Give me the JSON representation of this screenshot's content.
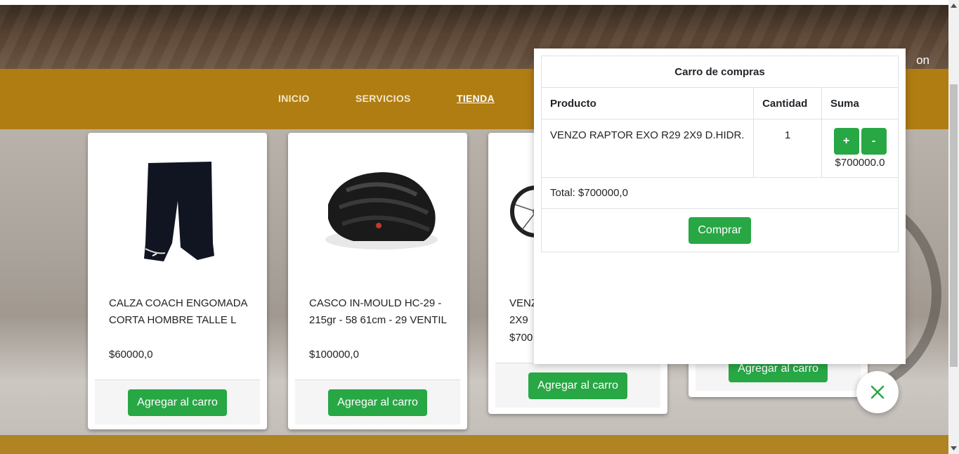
{
  "hero": {
    "login_text": "on"
  },
  "nav": {
    "items": [
      {
        "label": "INICIO",
        "active": false
      },
      {
        "label": "SERVICIOS",
        "active": false
      },
      {
        "label": "TIENDA",
        "active": true
      }
    ]
  },
  "products": [
    {
      "name": "CALZA COACH ENGOMADA CORTA HOMBRE TALLE L",
      "price": "$60000,0",
      "button": "Agregar al carro",
      "icon": "shorts-icon"
    },
    {
      "name": "CASCO IN-MOULD HC-29 - 215gr - 58 61cm - 29 VENTIL",
      "price": "$100000,0",
      "button": "Agregar al carro",
      "icon": "helmet-icon"
    },
    {
      "name": "VENZ 2X9",
      "price": "$700",
      "button": "Agregar al carro",
      "icon": "bicycle-icon"
    },
    {
      "name": "",
      "price": "",
      "button": "Agregar al carro",
      "icon": ""
    }
  ],
  "cart": {
    "title": "Carro de compras",
    "headers": {
      "product": "Producto",
      "quantity": "Cantidad",
      "sum": "Suma"
    },
    "items": [
      {
        "product": "VENZO RAPTOR EXO R29 2X9 D.HIDR.",
        "quantity": "1",
        "plus": "+",
        "minus": "-",
        "sum": "$700000.0"
      }
    ],
    "total": "Total: $700000,0",
    "buy_button": "Comprar"
  },
  "colors": {
    "nav_bg": "#b07d12",
    "accent_green": "#28a745"
  }
}
